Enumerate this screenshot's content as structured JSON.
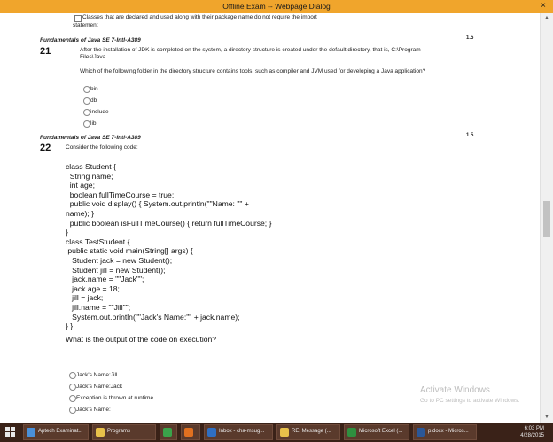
{
  "window": {
    "title": "Offline Exam -- Webpage Dialog",
    "close_label": "×"
  },
  "scrollbar": {
    "up": "▲",
    "down": "▼"
  },
  "prev_option": {
    "text_line1": "Classes that are declared and used along with their package name do not require the import",
    "text_line2": "statement"
  },
  "q21": {
    "section": "Fundamentals of Java SE 7-Intl-A389",
    "number": "21",
    "points": "1.5",
    "text1": "After the installation of JDK is completed on the system, a directory structure is created under the default directory, that is, C:\\Program",
    "text2": "Files\\Java.",
    "text3": "Which of the following folder in the directory structure contains tools, such as compiler and JVM used for developing a Java application?",
    "options": [
      "bin",
      "db",
      "include",
      "lib"
    ]
  },
  "q22": {
    "section": "Fundamentals of Java SE 7-Intl-A389",
    "number": "22",
    "points": "1.5",
    "intro": "Consider the following code:",
    "code": "class Student {\n  String name;\n  int age;\n  boolean fullTimeCourse = true;\n  public void display() { System.out.println(\"\"Name: \"\" +\nname); }\n  public boolean isFullTimeCourse() { return fullTimeCourse; }\n}\nclass TestStudent {\n public static void main(String[] args) {\n   Student jack = new Student();\n   Student jill = new Student();\n   jack.name = \"\"Jack\"\";\n   jack.age = 18;\n   jill = jack;\n   jill.name = \"\"Jill\"\";\n   System.out.println(\"\"Jack's Name:\"\" + jack.name);\n} }",
    "question": "What is the output of the code on execution?",
    "options": [
      "Jack's Name:Jill",
      "Jack's Name:Jack",
      "Exception is thrown at runtime",
      "Jack's Name:"
    ]
  },
  "watermark": {
    "line1": "Activate Windows",
    "line2": "Go to PC settings to activate Windows."
  },
  "taskbar": {
    "items": [
      {
        "label": "Aptech Examinat...",
        "color": "#4a90d9"
      },
      {
        "label": "Programs",
        "color": "#e8c14a"
      },
      {
        "label": "",
        "color": "#3aa34a"
      },
      {
        "label": "",
        "color": "#e07020"
      },
      {
        "label": "Inbox - cha-msug...",
        "color": "#2f6fc2"
      },
      {
        "label": "RE: Message (...",
        "color": "#e8c14a"
      },
      {
        "label": "Microsoft Excel (...",
        "color": "#2f8f3f"
      },
      {
        "label": "p.docx - Micros...",
        "color": "#2b5797"
      }
    ],
    "time": "6:03 PM",
    "date": "4/28/2015"
  }
}
